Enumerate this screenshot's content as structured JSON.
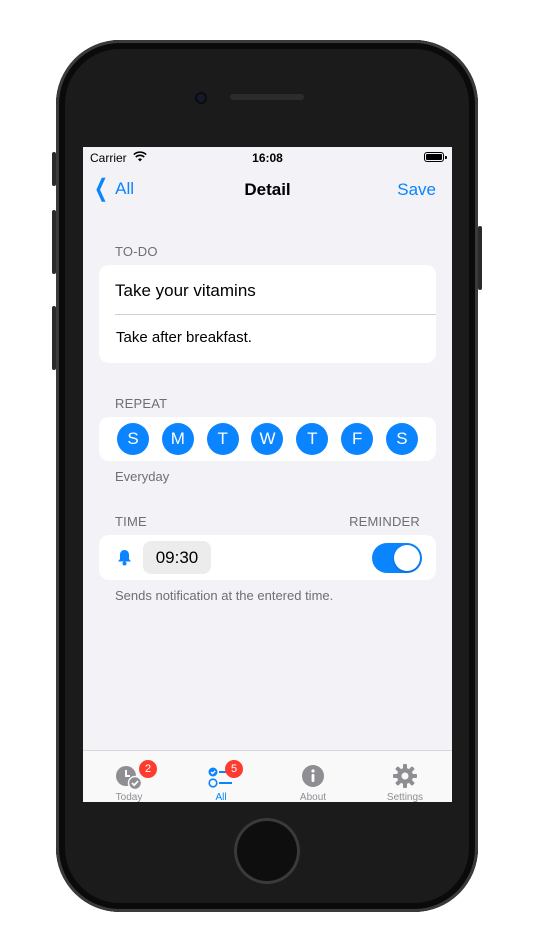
{
  "status_bar": {
    "carrier": "Carrier",
    "time": "16:08"
  },
  "nav": {
    "back_label": "All",
    "title": "Detail",
    "save_label": "Save"
  },
  "todo": {
    "section_label": "TO-DO",
    "title": "Take your vitamins",
    "note": "Take after breakfast."
  },
  "repeat": {
    "section_label": "REPEAT",
    "days": [
      "S",
      "M",
      "T",
      "W",
      "T",
      "F",
      "S"
    ],
    "summary": "Everyday"
  },
  "time": {
    "section_label": "TIME",
    "reminder_label": "REMINDER",
    "value": "09:30",
    "reminder_on": true,
    "footer": "Sends notification at the entered time."
  },
  "tabbar": {
    "tabs": [
      {
        "label": "Today",
        "icon": "clock-check-icon",
        "badge": "2"
      },
      {
        "label": "All",
        "icon": "list-icon",
        "badge": "5",
        "active": true
      },
      {
        "label": "About",
        "icon": "info-icon"
      },
      {
        "label": "Settings",
        "icon": "gear-icon"
      }
    ]
  },
  "colors": {
    "accent": "#0a84ff",
    "badge": "#ff3b30",
    "background": "#f2f2f7"
  }
}
